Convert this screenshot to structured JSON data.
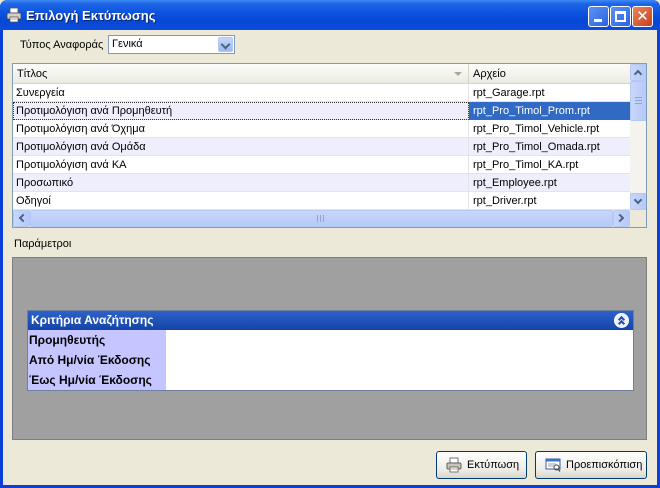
{
  "window": {
    "title": "Επιλογή Εκτύπωσης",
    "icon": "printer-icon",
    "controls": [
      "minimize-icon",
      "maximize-icon",
      "close-icon"
    ],
    "close_glyph": "✕"
  },
  "report_type": {
    "label": "Τύπος Αναφοράς",
    "selected": "Γενικά"
  },
  "report_grid": {
    "columns": [
      "Τίτλος",
      "Αρχείο"
    ],
    "selected_index": 1,
    "rows": [
      {
        "title": "Συνεργεία",
        "file": "rpt_Garage.rpt"
      },
      {
        "title": "Προτιμολόγιση ανά Προμηθευτή",
        "file": "rpt_Pro_Timol_Prom.rpt"
      },
      {
        "title": "Προτιμολόγιση ανά Όχημα",
        "file": "rpt_Pro_Timol_Vehicle.rpt"
      },
      {
        "title": "Προτιμολόγιση ανά Ομάδα",
        "file": "rpt_Pro_Timol_Omada.rpt"
      },
      {
        "title": "Προτιμολόγιση ανά ΚΑ",
        "file": "rpt_Pro_Timol_KA.rpt"
      },
      {
        "title": "Προσωπικό",
        "file": "rpt_Employee.rpt"
      },
      {
        "title": "Οδηγοί",
        "file": "rpt_Driver.rpt"
      }
    ]
  },
  "parameters": {
    "label": "Παράμετροι",
    "criteria_title": "Κριτήρια Αναζήτησης",
    "criteria": [
      "Προμηθευτής",
      "Από Ημ/νία Έκδοσης",
      "Έως Ημ/νία Έκδοσης"
    ]
  },
  "buttons": {
    "print": "Εκτύπωση",
    "preview": "Προεπισκόπιση"
  },
  "colors": {
    "titlebar": "#0a52e0",
    "selection": "#316ac5",
    "criteria_header": "#1f52b8",
    "criteria_labels": "#c5c5ff",
    "params_panel": "#a0a0a0"
  }
}
